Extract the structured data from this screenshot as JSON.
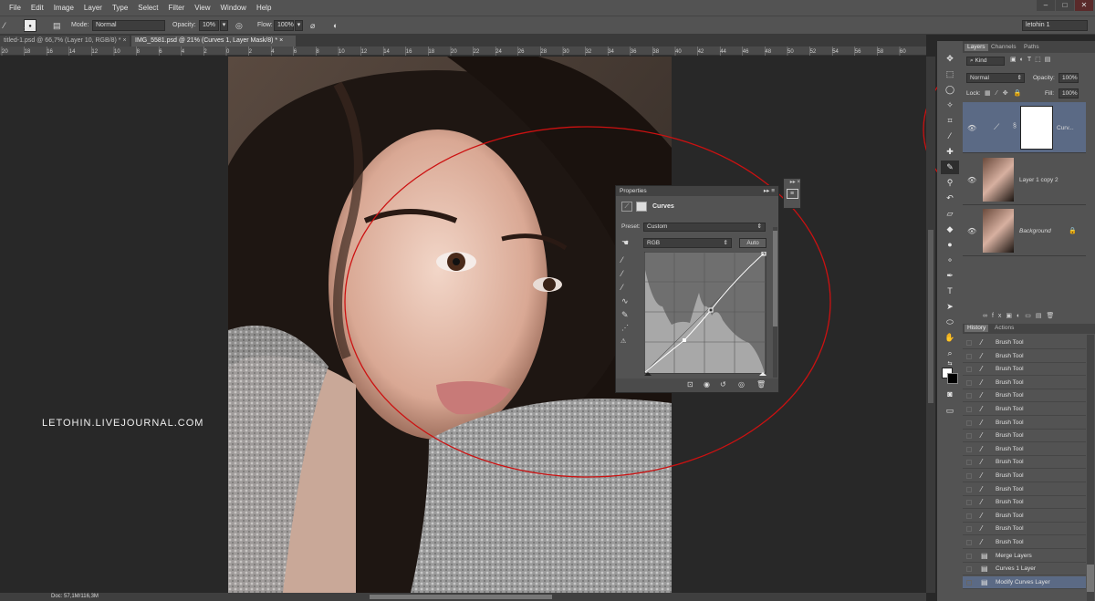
{
  "menu": [
    "File",
    "Edit",
    "Image",
    "Layer",
    "Type",
    "Select",
    "Filter",
    "View",
    "Window",
    "Help"
  ],
  "window_controls": [
    "–",
    "□",
    "✕"
  ],
  "options": {
    "brush_size": "1998",
    "mode_label": "Mode:",
    "mode_value": "Normal",
    "opacity_label": "Opacity:",
    "opacity_value": "10%",
    "flow_label": "Flow:",
    "flow_value": "100%",
    "workspace": "letohin 1"
  },
  "doc_tabs": [
    {
      "label": "titled-1.psd @ 66,7% (Layer 10, RGB/8) *",
      "close": "×"
    },
    {
      "label": "IMG_5581.psd @ 21% (Curves 1, Layer Mask/8) *",
      "close": "×"
    }
  ],
  "ruler_ticks": [
    "20",
    "18",
    "16",
    "14",
    "12",
    "10",
    "8",
    "6",
    "4",
    "2",
    "0",
    "2",
    "4",
    "6",
    "8",
    "10",
    "12",
    "14",
    "16",
    "18",
    "20",
    "22",
    "24",
    "26",
    "28",
    "30",
    "32",
    "34",
    "36",
    "38",
    "40",
    "42",
    "44",
    "46",
    "48",
    "50",
    "52",
    "54",
    "56",
    "58",
    "60"
  ],
  "watermark": "LETOHIN.LIVEJOURNAL.COM",
  "status_text": "Doc: 57,1M/116,3M",
  "properties": {
    "title": "Properties",
    "panel_name": "Curves",
    "preset_label": "Preset:",
    "preset_value": "Custom",
    "channel_value": "RGB",
    "auto_label": "Auto"
  },
  "panel_tabs": [
    "Layers",
    "Channels",
    "Paths"
  ],
  "layers_panel": {
    "kind_label": "Kind",
    "blend_mode": "Normal",
    "opacity_label": "Opacity:",
    "opacity_value": "100%",
    "lock_label": "Lock:",
    "fill_label": "Fill:",
    "fill_value": "100%",
    "layers": [
      {
        "name": "Curv...",
        "selected": true
      },
      {
        "name": "Layer 1 copy 2",
        "selected": false
      },
      {
        "name": "Background",
        "selected": false
      }
    ]
  },
  "history_tabs": [
    "History",
    "Actions"
  ],
  "history": [
    "Brush Tool",
    "Brush Tool",
    "Brush Tool",
    "Brush Tool",
    "Brush Tool",
    "Brush Tool",
    "Brush Tool",
    "Brush Tool",
    "Brush Tool",
    "Brush Tool",
    "Brush Tool",
    "Brush Tool",
    "Brush Tool",
    "Brush Tool",
    "Brush Tool",
    "Brush Tool",
    "Merge Layers",
    "Curves 1 Layer",
    "Modify Curves Layer"
  ],
  "colors": {
    "annotation": "#cc1111",
    "selected": "#5b6a85"
  }
}
